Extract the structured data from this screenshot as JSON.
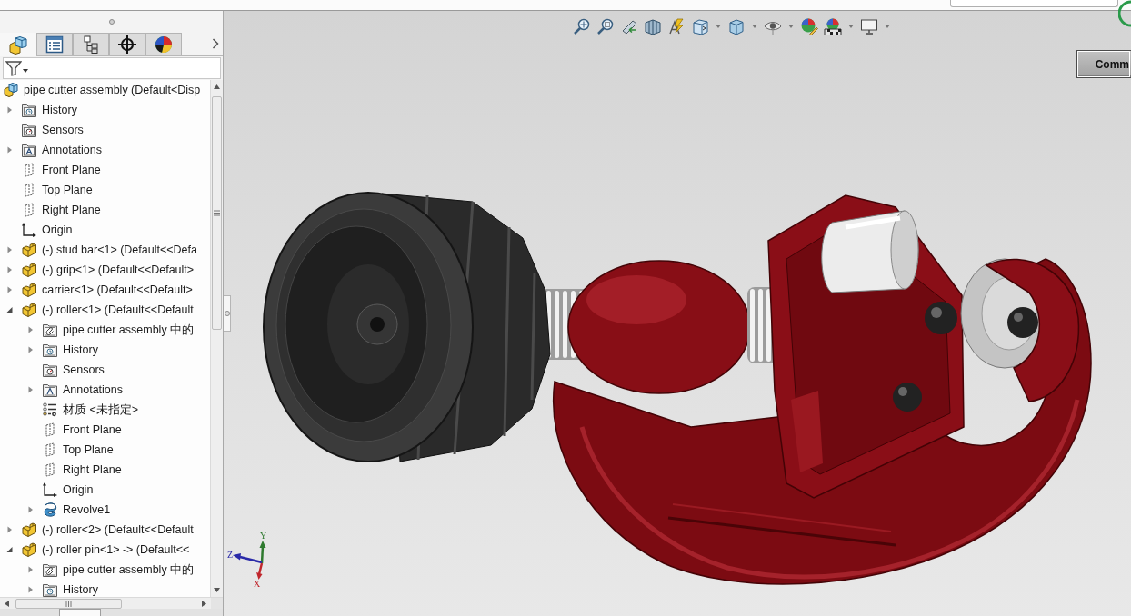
{
  "feature_tree": {
    "tabs": [
      {
        "kind": "assembly",
        "selected": true
      },
      {
        "kind": "list",
        "selected": false
      },
      {
        "kind": "hierarchy",
        "selected": false
      },
      {
        "kind": "crosshair",
        "selected": false
      },
      {
        "kind": "appearance",
        "selected": false
      }
    ],
    "items": [
      {
        "kind": "assembly",
        "label": "pipe cutter assembly (Default<Disp",
        "children": [
          {
            "kind": "history",
            "label": "History",
            "expanded": false
          },
          {
            "kind": "sensors",
            "label": "Sensors"
          },
          {
            "kind": "annotations",
            "label": "Annotations",
            "expanded": false
          },
          {
            "kind": "plane",
            "label": "Front Plane"
          },
          {
            "kind": "plane",
            "label": "Top Plane"
          },
          {
            "kind": "plane",
            "label": "Right Plane"
          },
          {
            "kind": "origin",
            "label": "Origin"
          },
          {
            "kind": "part",
            "label": "(-) stud bar<1> (Default<<Defa",
            "expanded": false
          },
          {
            "kind": "part",
            "label": "(-) grip<1> (Default<<Default>",
            "expanded": false
          },
          {
            "kind": "part",
            "label": "carrier<1> (Default<<Default>",
            "expanded": false
          },
          {
            "kind": "part",
            "label": "(-) roller<1> (Default<<Default",
            "expanded": true,
            "children": [
              {
                "kind": "mates",
                "label": "pipe cutter assembly 中的",
                "expanded": false
              },
              {
                "kind": "history",
                "label": "History",
                "expanded": false
              },
              {
                "kind": "sensors",
                "label": "Sensors"
              },
              {
                "kind": "annotations",
                "label": "Annotations",
                "expanded": false
              },
              {
                "kind": "material",
                "label": "材质 <未指定>"
              },
              {
                "kind": "plane",
                "label": "Front Plane"
              },
              {
                "kind": "plane",
                "label": "Top Plane"
              },
              {
                "kind": "plane",
                "label": "Right Plane"
              },
              {
                "kind": "origin",
                "label": "Origin"
              },
              {
                "kind": "revolve",
                "label": "Revolve1",
                "expanded": false
              }
            ]
          },
          {
            "kind": "part",
            "label": "(-) roller<2> (Default<<Default",
            "expanded": false
          },
          {
            "kind": "part",
            "label": "(-) roller pin<1> -> (Default<<",
            "expanded": true,
            "children": [
              {
                "kind": "mates",
                "label": "pipe cutter assembly 中的",
                "expanded": false
              },
              {
                "kind": "history",
                "label": "History",
                "expanded": false
              }
            ]
          }
        ]
      }
    ]
  },
  "viewport": {
    "side_button": {
      "label": "Comm"
    },
    "triad": {
      "axes": [
        {
          "label": "Y",
          "color": "#2f7a2f"
        },
        {
          "label": "Z",
          "color": "#2a2aa8"
        },
        {
          "label": "X",
          "color": "#c0262c"
        }
      ]
    }
  }
}
